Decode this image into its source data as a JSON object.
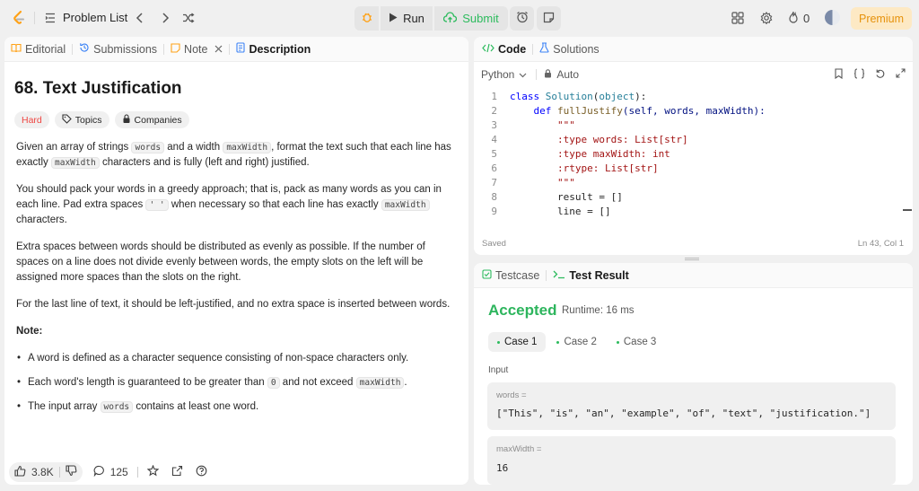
{
  "topbar": {
    "problem_list": "Problem List",
    "run": "Run",
    "submit": "Submit",
    "fire_count": "0",
    "premium": "Premium"
  },
  "left_tabs": {
    "editorial": "Editorial",
    "submissions": "Submissions",
    "note": "Note",
    "description": "Description"
  },
  "problem": {
    "title": "68. Text Justification",
    "difficulty": "Hard",
    "topics": "Topics",
    "companies": "Companies",
    "p1": {
      "a": "Given an array of strings ",
      "c1": "words",
      "b": " and a width ",
      "c2": "maxWidth",
      "c": ", format the text such that each line has exactly ",
      "c3": "maxWidth",
      "d": " characters and is fully (left and right) justified."
    },
    "p2": {
      "a": "You should pack your words in a greedy approach; that is, pack as many words as you can in each line. Pad extra spaces ",
      "c1": "' '",
      "b": " when necessary so that each line has exactly ",
      "c2": "maxWidth",
      "c": " characters."
    },
    "p3": "Extra spaces between words should be distributed as evenly as possible. If the number of spaces on a line does not divide evenly between words, the empty slots on the left will be assigned more spaces than the slots on the right.",
    "p4": "For the last line of text, it should be left-justified, and no extra space is inserted between words.",
    "note_heading": "Note:",
    "notes": {
      "n1": "A word is defined as a character sequence consisting of non-space characters only.",
      "n2a": "Each word's length is guaranteed to be greater than ",
      "n2c1": "0",
      "n2b": " and not exceed ",
      "n2c2": "maxWidth",
      "n2c": ".",
      "n3a": "The input array ",
      "n3c": "words",
      "n3b": " contains at least one word."
    }
  },
  "footer": {
    "likes": "3.8K",
    "comments": "125"
  },
  "code_panel": {
    "code_tab": "Code",
    "solutions_tab": "Solutions",
    "language": "Python",
    "mode": "Auto",
    "saved": "Saved",
    "cursor": "Ln 43, Col 1"
  },
  "code_lines": [
    "1",
    "2",
    "3",
    "4",
    "5",
    "6",
    "7",
    "8",
    "9"
  ],
  "code": {
    "l1": {
      "kw": "class",
      "sp": " ",
      "cls": "Solution",
      "lp": "(",
      "base": "object",
      "rp": "):"
    },
    "l2": {
      "ind": "    ",
      "kw": "def",
      "sp": " ",
      "fn": "fullJustify",
      "args": "(self, words, maxWidth):"
    },
    "l3": "        \"\"\"",
    "l4": "        :type words: List[str]",
    "l5": "        :type maxWidth: int",
    "l6": "        :rtype: List[str]",
    "l7": "        \"\"\"",
    "l8": "        result = []",
    "l9": "        line = []"
  },
  "test_panel": {
    "testcase_tab": "Testcase",
    "result_tab": "Test Result",
    "status": "Accepted",
    "runtime": "Runtime: 16 ms",
    "cases": [
      "Case 1",
      "Case 2",
      "Case 3"
    ],
    "input_label": "Input",
    "words_label": "words =",
    "words_value": "[\"This\", \"is\", \"an\", \"example\", \"of\", \"text\", \"justification.\"]",
    "maxwidth_label": "maxWidth =",
    "maxwidth_value": "16"
  },
  "colors": {
    "accent_orange": "#ffa116",
    "accepted_green": "#2db55d",
    "hard_red": "#ef4743",
    "submit_green": "#2cbb5d",
    "premium_bg": "#fde9c4",
    "premium_text": "#e6920c"
  }
}
